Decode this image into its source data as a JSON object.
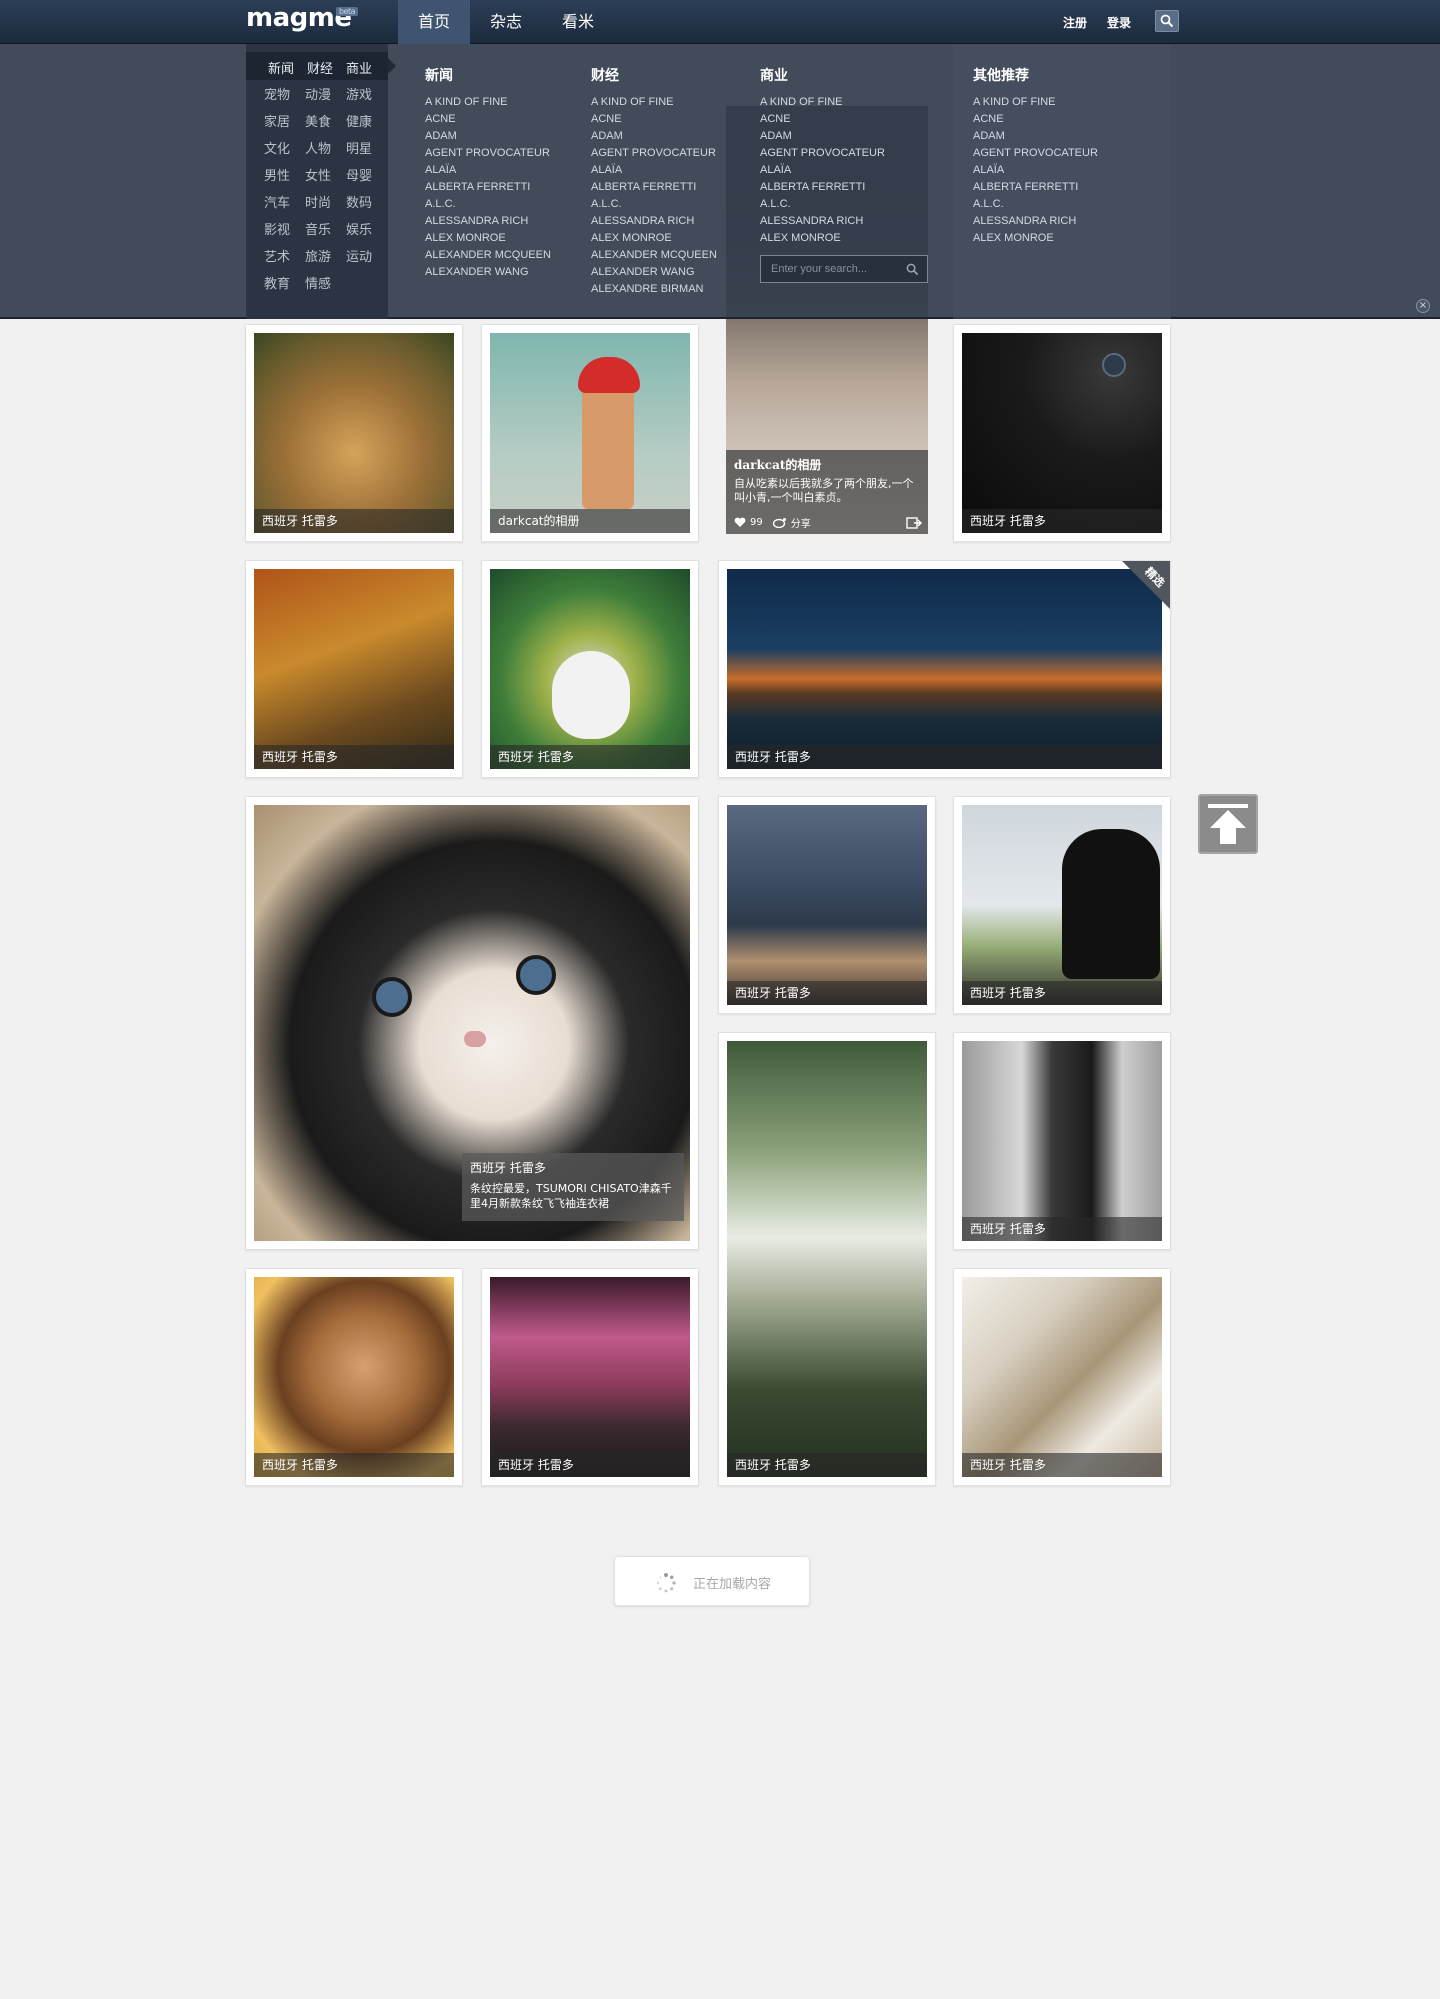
{
  "header": {
    "logo": "magme",
    "logo_badge": "beta",
    "nav": [
      {
        "label": "首页",
        "active": true
      },
      {
        "label": "杂志",
        "active": false
      },
      {
        "label": "看米",
        "active": false
      }
    ],
    "register": "注册",
    "login": "登录",
    "search_icon": "search-icon"
  },
  "dropdown": {
    "tabs": [
      "新闻",
      "财经",
      "商业"
    ],
    "categories": [
      "宠物",
      "动漫",
      "游戏",
      "家居",
      "美食",
      "健康",
      "文化",
      "人物",
      "明星",
      "男性",
      "女性",
      "母婴",
      "汽车",
      "时尚",
      "数码",
      "影视",
      "音乐",
      "娱乐",
      "艺术",
      "旅游",
      "运动",
      "教育",
      "情感"
    ],
    "columns": [
      {
        "title": "新闻",
        "items": [
          "A KIND OF FINE",
          "ACNE",
          "ADAM",
          "AGENT PROVOCATEUR",
          "ALAÏA",
          "ALBERTA FERRETTI",
          "A.L.C.",
          "ALESSANDRA RICH",
          "ALEX MONROE",
          "ALEXANDER MCQUEEN",
          "ALEXANDER WANG"
        ]
      },
      {
        "title": "财经",
        "items": [
          "A KIND OF FINE",
          "ACNE",
          "ADAM",
          "AGENT PROVOCATEUR",
          "ALAÏA",
          "ALBERTA FERRETTI",
          "A.L.C.",
          "ALESSANDRA RICH",
          "ALEX MONROE",
          "ALEXANDER MCQUEEN",
          "ALEXANDER WANG",
          "ALEXANDRE BIRMAN"
        ]
      },
      {
        "title": "商业",
        "items": [
          "A KIND OF FINE",
          "ACNE",
          "ADAM",
          "AGENT PROVOCATEUR",
          "ALAÏA",
          "ALBERTA FERRETTI",
          "A.L.C.",
          "ALESSANDRA RICH",
          "ALEX MONROE"
        ]
      },
      {
        "title": "其他推荐",
        "items": [
          "A KIND OF FINE",
          "ACNE",
          "ADAM",
          "AGENT PROVOCATEUR",
          "ALAÏA",
          "ALBERTA FERRETTI",
          "A.L.C.",
          "ALESSANDRA RICH",
          "ALEX MONROE"
        ]
      }
    ],
    "search_placeholder": "Enter your search...",
    "close_icon": "close-icon"
  },
  "cards": {
    "c1": "西班牙 托雷多",
    "c2": "darkcat的相册",
    "featured": {
      "title": "darkcat的相册",
      "text": "自从吃素以后我就多了两个朋友,一个叫小青,一个叫白素贞。",
      "likes": "99",
      "share": "分享"
    },
    "c4": "西班牙 托雷多",
    "c5": "西班牙 托雷多",
    "c6": "西班牙 托雷多",
    "c7": "西班牙 托雷多",
    "c7_badge": "精选",
    "cat": {
      "title": "西班牙 托雷多",
      "text": "条纹控最爱，TSUMORI CHISATO津森千里4月新款条纹飞飞袖连衣裙"
    },
    "c9": "西班牙 托雷多",
    "c10": "西班牙 托雷多",
    "c11": "西班牙 托雷多",
    "c12": "西班牙 托雷多",
    "c13": "西班牙 托雷多",
    "c14": "西班牙 托雷多",
    "c15": "西班牙 托雷多"
  },
  "loading": "正在加载内容",
  "colors": {
    "topbar": "#1c2a3c",
    "dropdown": "#343e4e",
    "page": "#f1f1f1"
  }
}
